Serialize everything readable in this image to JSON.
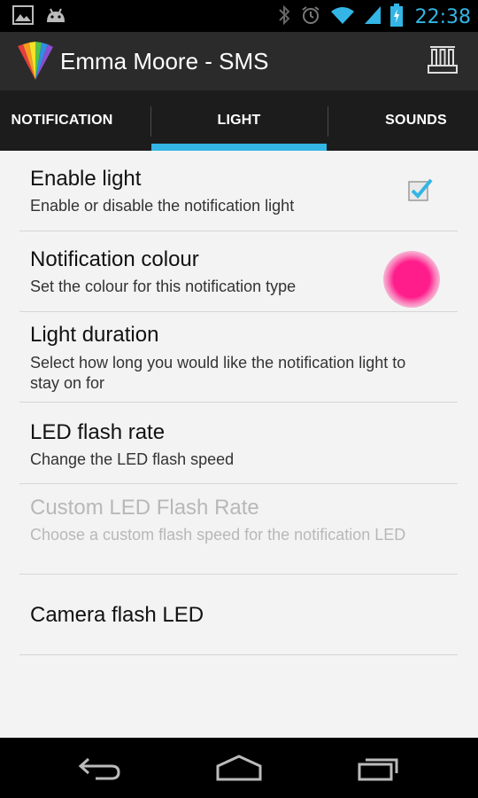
{
  "status_bar": {
    "time": "22:38",
    "left_icons": [
      "gallery-icon",
      "android-icon"
    ],
    "right_icons": [
      "bluetooth-icon",
      "alarm-icon",
      "wifi-icon",
      "signal-icon",
      "battery-icon"
    ],
    "accent_color": "#33b5e5"
  },
  "action_bar": {
    "title": "Emma Moore - SMS",
    "logo_icon": "app-rainbow-logo-icon",
    "overflow_icon": "settings-rack-icon"
  },
  "tabs": [
    {
      "label": "NOTIFICATION",
      "selected": false
    },
    {
      "label": "LIGHT",
      "selected": true
    },
    {
      "label": "SOUNDS",
      "selected": false
    }
  ],
  "preferences": [
    {
      "title": "Enable light",
      "summary": "Enable or disable the notification light",
      "widget": "checkbox",
      "checked": true,
      "enabled": true
    },
    {
      "title": "Notification colour",
      "summary": "Set the colour for this notification type",
      "widget": "color",
      "color": "#ff1d8b",
      "enabled": true
    },
    {
      "title": "Light duration",
      "summary": "Select how long you would like the notification light to stay on for",
      "enabled": true
    },
    {
      "title": "LED flash rate",
      "summary": "Change the LED flash speed",
      "enabled": true
    },
    {
      "title": "Custom LED Flash Rate",
      "summary": "Choose a custom flash speed for the notification LED",
      "enabled": false
    },
    {
      "title": "Camera flash LED",
      "summary": "",
      "enabled": true
    }
  ],
  "nav_bar": {
    "buttons": [
      "back-icon",
      "home-icon",
      "recent-apps-icon"
    ]
  }
}
